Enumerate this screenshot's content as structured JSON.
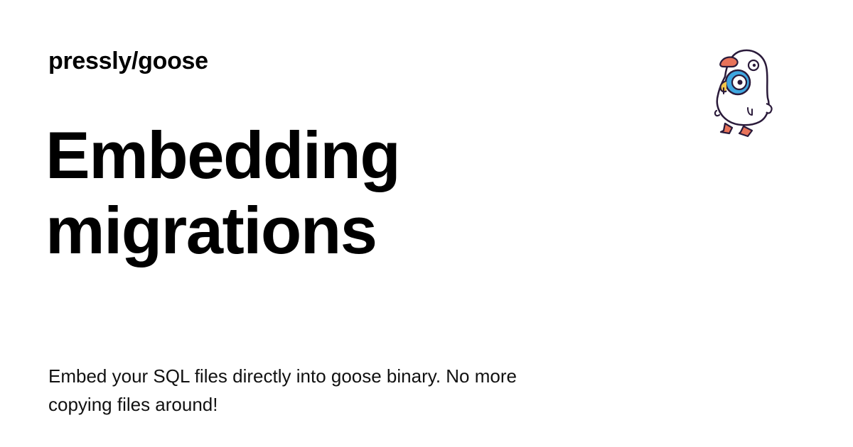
{
  "header": {
    "site_name": "pressly/goose"
  },
  "main": {
    "title_line_1": "Embedding",
    "title_line_2": "migrations",
    "description": "Embed your SQL files directly into goose binary. No more copying files around!"
  },
  "mascot": {
    "icon": "goose-mascot-icon"
  },
  "colors": {
    "background": "#ffffff",
    "text": "#000000",
    "mascot_blue": "#3fa7e0",
    "mascot_orange": "#e8735a",
    "mascot_yellow": "#f2c64a"
  }
}
